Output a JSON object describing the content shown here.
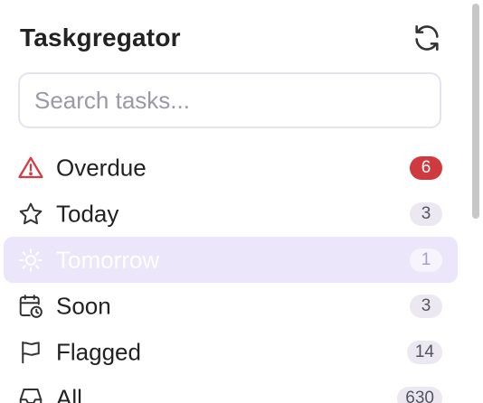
{
  "app": {
    "title": "Taskgregator"
  },
  "search": {
    "placeholder": "Search tasks..."
  },
  "nav": {
    "items": [
      {
        "label": "Overdue",
        "count": "6",
        "icon": "warning-triangle-icon"
      },
      {
        "label": "Today",
        "count": "3",
        "icon": "star-icon"
      },
      {
        "label": "Tomorrow",
        "count": "1",
        "icon": "sun-icon",
        "selected": true
      },
      {
        "label": "Soon",
        "count": "3",
        "icon": "calendar-clock-icon"
      },
      {
        "label": "Flagged",
        "count": "14",
        "icon": "flag-icon"
      },
      {
        "label": "All",
        "count": "630",
        "icon": "inbox-icon"
      }
    ]
  },
  "colors": {
    "accent": "#ece6fb",
    "danger": "#cf3a3f",
    "text": "#222222"
  }
}
